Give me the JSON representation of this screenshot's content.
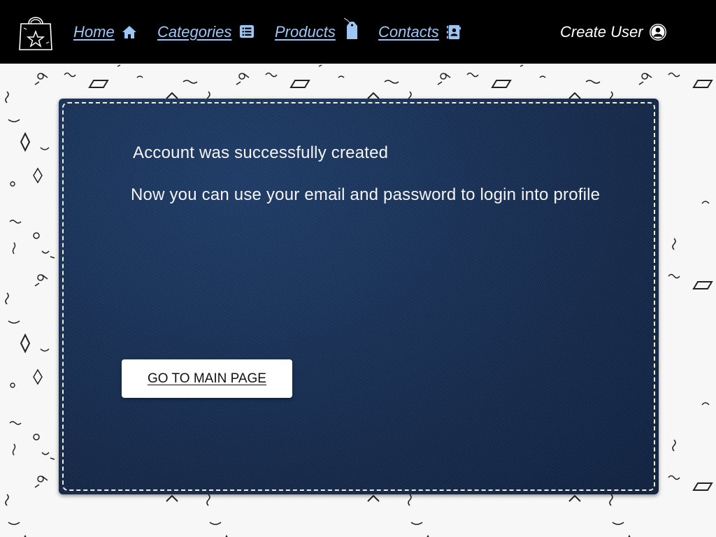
{
  "nav": {
    "logo_icon": "shopping-bag-star-icon",
    "links": [
      {
        "label": "Home",
        "icon": "home-icon"
      },
      {
        "label": "Categories",
        "icon": "list-icon"
      },
      {
        "label": "Products",
        "icon": "price-tag-icon"
      },
      {
        "label": "Contacts",
        "icon": "address-book-icon"
      }
    ],
    "create_user": {
      "label": "Create User",
      "icon": "user-circle-icon"
    }
  },
  "card": {
    "title": "Account was successfully created",
    "message": "Now you can use your email and password to login into profile",
    "button_label": "GO TO MAIN PAGE"
  },
  "colors": {
    "navbar_bg": "#000000",
    "nav_link": "#9ec6f5",
    "card_bg": "#173156",
    "stitch": "#f3eed2",
    "page_bg": "#f7f7f7"
  }
}
